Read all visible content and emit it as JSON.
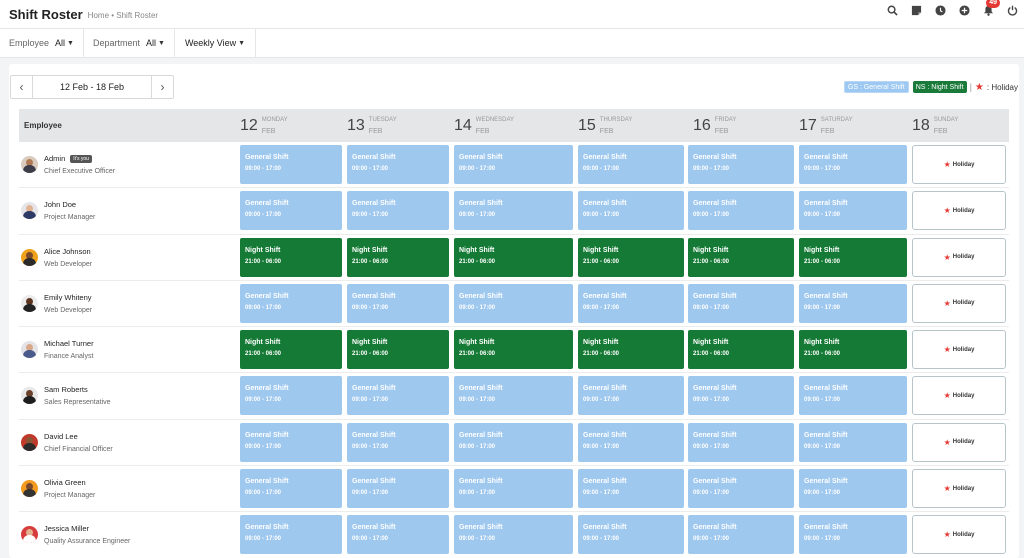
{
  "header": {
    "title": "Shift Roster",
    "breadcrumb": "Home • Shift Roster",
    "icons": [
      "search-icon",
      "note-icon",
      "clock-icon",
      "plus-circle-icon",
      "bell-icon",
      "power-icon"
    ],
    "notification_count": "49"
  },
  "filters": {
    "employee_label": "Employee",
    "employee_value": "All",
    "department_label": "Department",
    "department_value": "All",
    "view_value": "Weekly View"
  },
  "date_nav": {
    "prev": "‹",
    "next": "›",
    "range": "12 Feb - 18 Feb"
  },
  "legend": {
    "gs": "GS : General Shift",
    "ns": "NS : Night Shift",
    "sep": "|",
    "holiday_star": "★",
    "holiday": ": Holiday"
  },
  "grid": {
    "employee_header": "Employee",
    "days": [
      {
        "num": "12",
        "name": "MONDAY",
        "month": "FEB"
      },
      {
        "num": "13",
        "name": "TUESDAY",
        "month": "FEB"
      },
      {
        "num": "14",
        "name": "WEDNESDAY",
        "month": "FEB"
      },
      {
        "num": "15",
        "name": "THURSDAY",
        "month": "FEB"
      },
      {
        "num": "16",
        "name": "FRIDAY",
        "month": "FEB"
      },
      {
        "num": "17",
        "name": "SATURDAY",
        "month": "FEB"
      },
      {
        "num": "18",
        "name": "SUNDAY",
        "month": "FEB"
      }
    ],
    "shift_labels": {
      "gs_name": "General Shift",
      "gs_time": "09:00 - 17:00",
      "ns_name": "Night Shift",
      "ns_time": "21:00 - 06:00",
      "holiday": "Holiday",
      "holiday_star": "★"
    },
    "employees": [
      {
        "name": "Admin",
        "badge": "It's you",
        "title": "Chief Executive Officer",
        "shift": "gs",
        "colors": {
          "bg": "#d9cbbd",
          "face": "#b07a55",
          "body": "#3d3d4a"
        }
      },
      {
        "name": "John Doe",
        "badge": "",
        "title": "Project Manager",
        "shift": "gs",
        "colors": {
          "bg": "#e6e6ea",
          "face": "#e0b493",
          "body": "#2d3a66"
        }
      },
      {
        "name": "Alice Johnson",
        "badge": "",
        "title": "Web Developer",
        "shift": "ns",
        "colors": {
          "bg": "#f0a21c",
          "face": "#7a4a2c",
          "body": "#2a2a2a"
        }
      },
      {
        "name": "Emily Whiteny",
        "badge": "",
        "title": "Web Developer",
        "shift": "gs",
        "colors": {
          "bg": "#ececec",
          "face": "#5a3420",
          "body": "#222222"
        }
      },
      {
        "name": "Michael Turner",
        "badge": "",
        "title": "Finance Analyst",
        "shift": "ns",
        "colors": {
          "bg": "#e4e4e8",
          "face": "#d8a888",
          "body": "#4a5a8a"
        }
      },
      {
        "name": "Sam Roberts",
        "badge": "",
        "title": "Sales Representative",
        "shift": "gs",
        "colors": {
          "bg": "#e8e8e8",
          "face": "#6b4028",
          "body": "#1e1e1e"
        }
      },
      {
        "name": "David Lee",
        "badge": "",
        "title": "Chief Financial Officer",
        "shift": "gs",
        "colors": {
          "bg": "#c0392b",
          "face": "#8a5636",
          "body": "#2b2b2b"
        }
      },
      {
        "name": "Olivia Green",
        "badge": "",
        "title": "Project Manager",
        "shift": "gs",
        "colors": {
          "bg": "#f29b1e",
          "face": "#7b4a2d",
          "body": "#333333"
        }
      },
      {
        "name": "Jessica Miller",
        "badge": "",
        "title": "Quality Assurance Engineer",
        "shift": "gs",
        "colors": {
          "bg": "#d63c3c",
          "face": "#e2b38e",
          "body": "#ffffff"
        }
      }
    ]
  }
}
